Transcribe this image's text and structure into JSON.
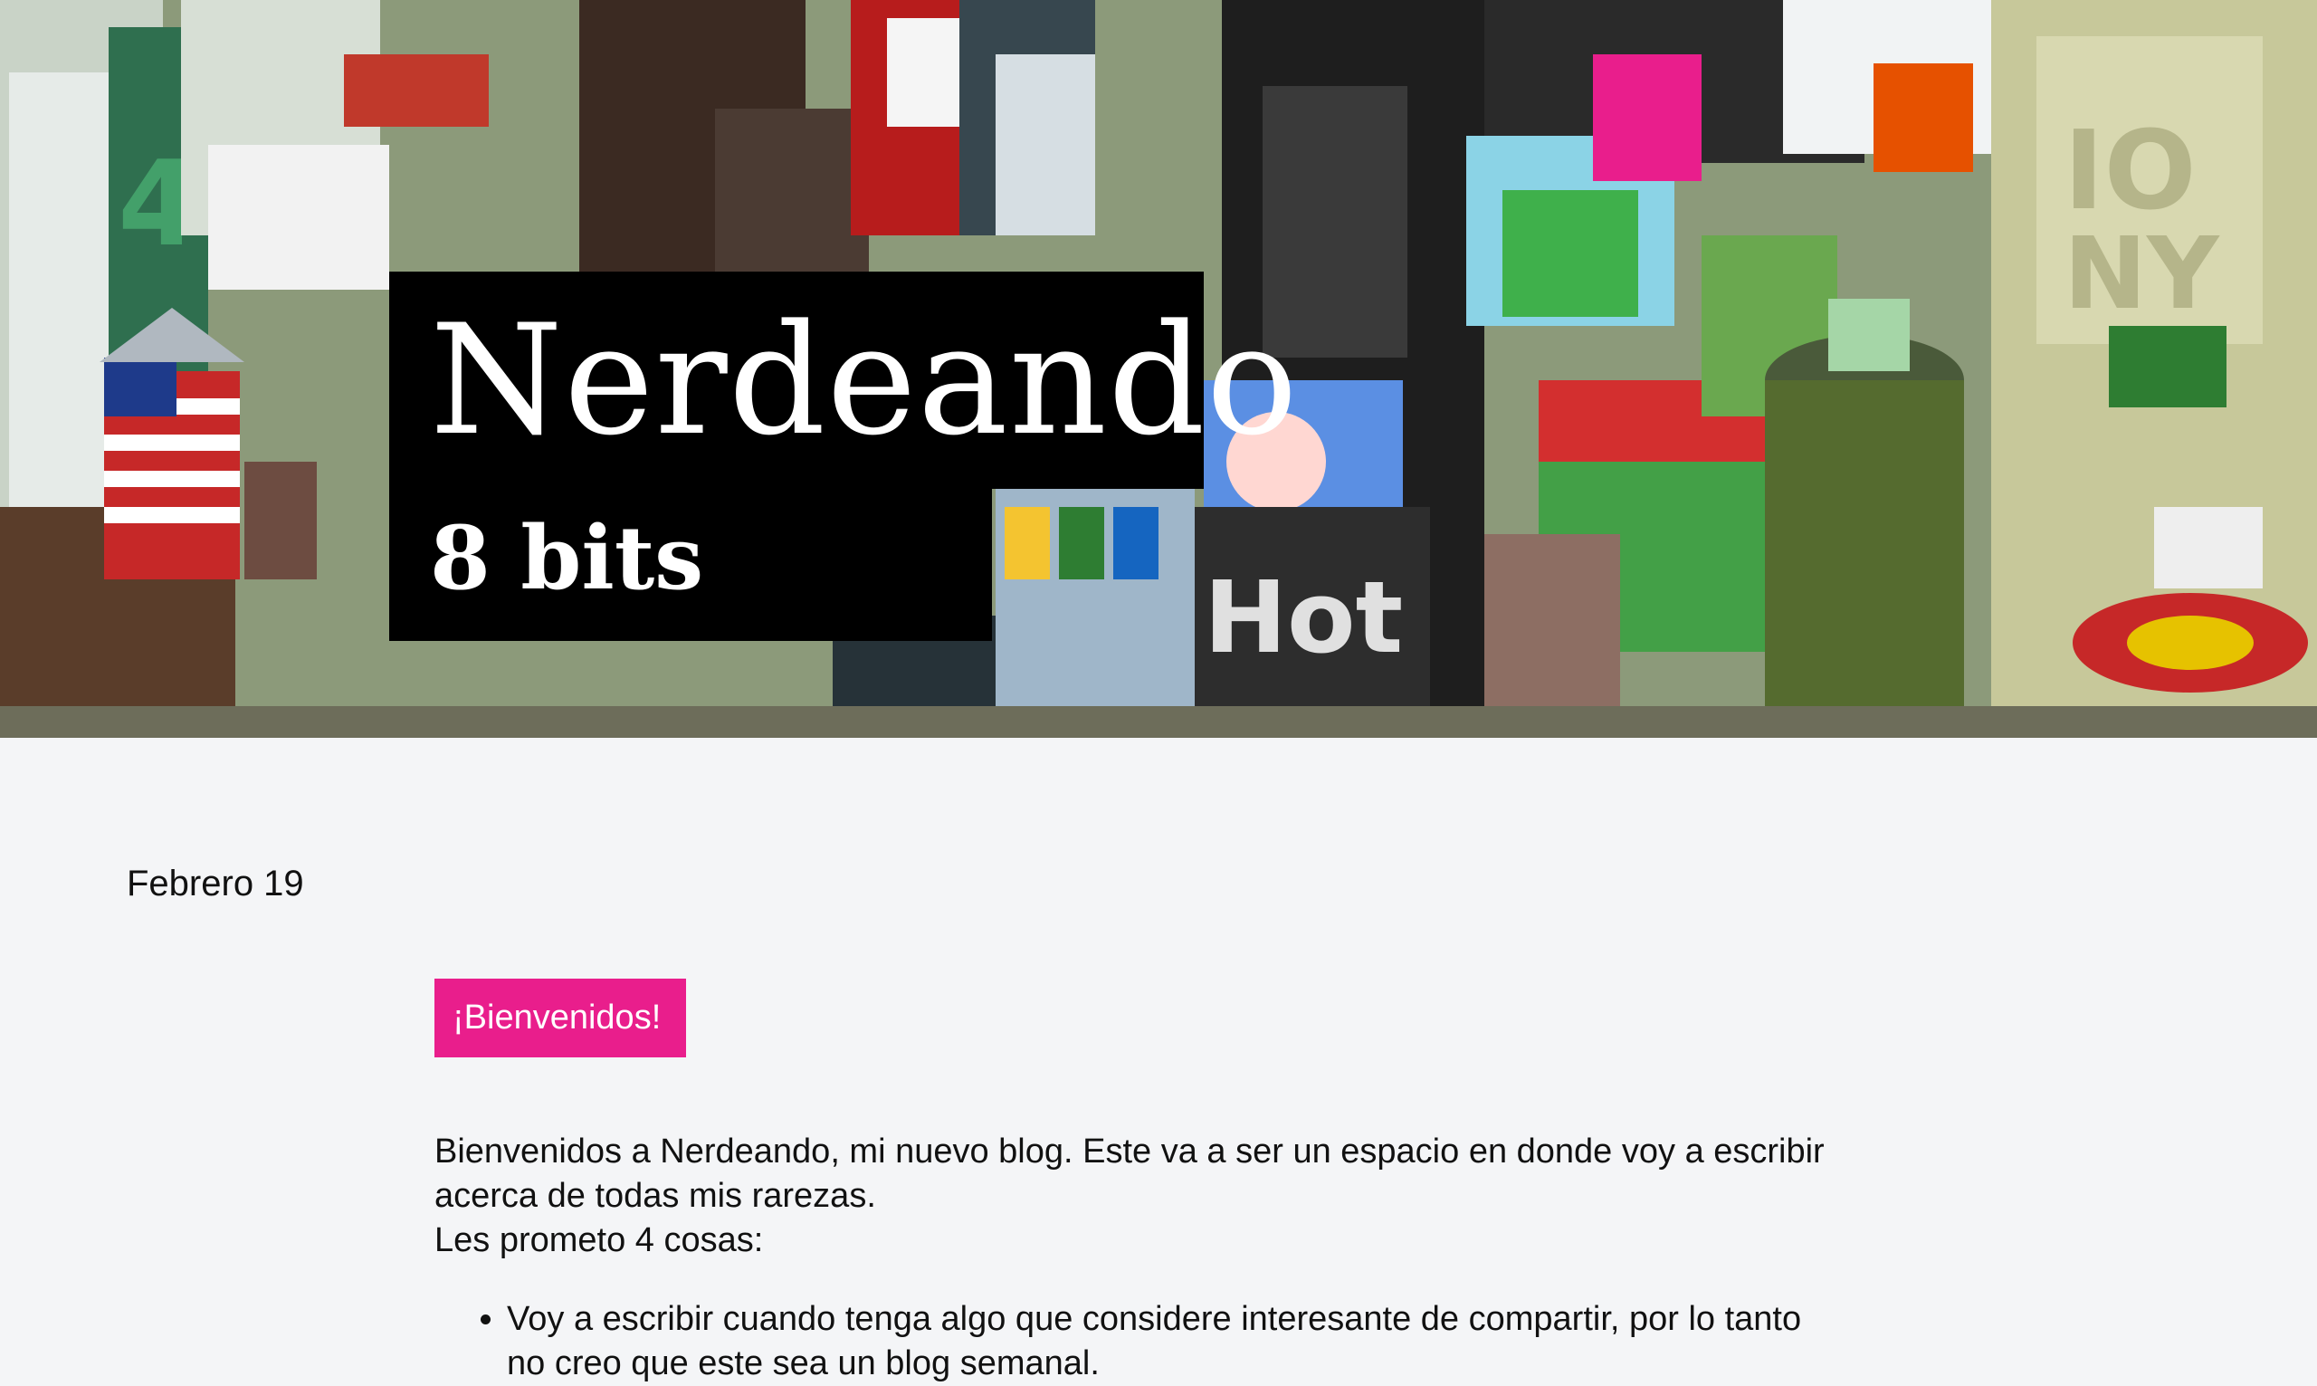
{
  "header": {
    "title": "Nerdeando",
    "subtitle": "8 bits",
    "banner_image": "pixel-art-city-illustration"
  },
  "post": {
    "date": "Febrero 19",
    "tag": "¡Bienvenidos!",
    "paragraph_1": "Bienvenidos a Nerdeando, mi nuevo blog. Este va a ser un espacio en donde voy a escribir acerca de todas mis rarezas.",
    "paragraph_2": "Les prometo 4 cosas:",
    "list": [
      "Voy a escribir cuando tenga algo que considere interesante de compartir, por lo tanto no creo que este sea un blog semanal."
    ]
  },
  "colors": {
    "page_background": "#f4f5f7",
    "title_box": "#000000",
    "tag_background": "#e91e8c",
    "tag_text": "#ffffff"
  }
}
